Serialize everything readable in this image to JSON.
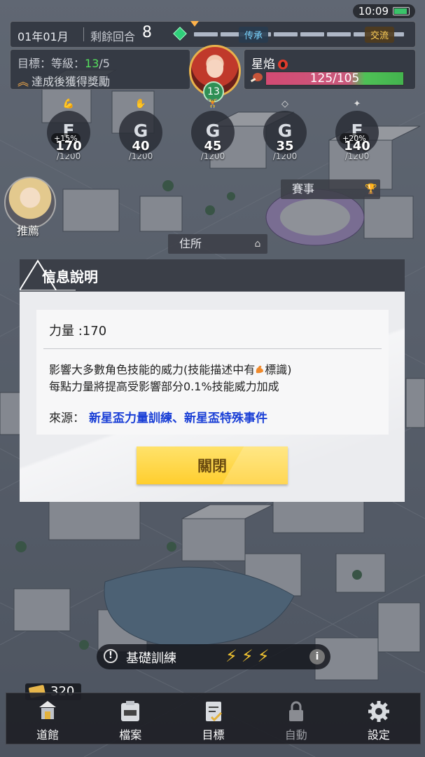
{
  "status_bar": {
    "time": "10:09"
  },
  "top_bar": {
    "date": "01年01月",
    "rounds_label": "剩餘回合",
    "rounds_value": "8",
    "track_label_inherit": "传承",
    "track_label_exchange": "交流"
  },
  "goal": {
    "prefix": "目標：等級：",
    "current": "13",
    "target": "/5",
    "reward_text": "達成後獲得獎勵"
  },
  "character": {
    "name": "星焰",
    "hp_text": "125/105",
    "level_badge": "13"
  },
  "stats": [
    {
      "icon": "muscle-icon",
      "grade": "F",
      "bonus": "+15%",
      "value": "170",
      "max": "/1200"
    },
    {
      "icon": "hand-icon",
      "grade": "G",
      "bonus": "",
      "value": "40",
      "max": "/1200"
    },
    {
      "icon": "dumbbell-icon",
      "grade": "G",
      "bonus": "",
      "value": "45",
      "max": "/1200"
    },
    {
      "icon": "diamond-icon",
      "grade": "G",
      "bonus": "",
      "value": "35",
      "max": "/1200"
    },
    {
      "icon": "brain-icon",
      "grade": "F",
      "bonus": "+20%",
      "value": "140",
      "max": "/1200"
    }
  ],
  "recommend_label": "推薦",
  "map_tags": {
    "event": "賽事",
    "home": "住所"
  },
  "dialog": {
    "title": "信息說明",
    "attr_line": "力量 :170",
    "desc_line1_a": "影響大多數角色技能的威力(技能描述中有",
    "desc_line1_b": "標識)",
    "desc_line2": "每點力量將提高受影響部分0.1%技能威力加成",
    "source_label": "來源：",
    "source_links": "新星盃力量訓練、新星盃特殊事件",
    "close_button": "關閉"
  },
  "training": {
    "label": "基礎訓練",
    "bolts": "⚡⚡⚡",
    "info": "i",
    "warn": "!"
  },
  "ticket_count": "320",
  "nav": [
    {
      "label": "道館",
      "icon": "gym-icon",
      "enabled": true
    },
    {
      "label": "檔案",
      "icon": "folder-icon",
      "enabled": true
    },
    {
      "label": "目標",
      "icon": "checklist-icon",
      "enabled": true
    },
    {
      "label": "自動",
      "icon": "lock-icon",
      "enabled": false
    },
    {
      "label": "設定",
      "icon": "gear-icon",
      "enabled": true
    }
  ],
  "colors": {
    "accent_gold": "#ffce2e",
    "goal_green": "#55e05d",
    "link_blue": "#1a3fd6",
    "panel_dark": "#3b3f48"
  }
}
